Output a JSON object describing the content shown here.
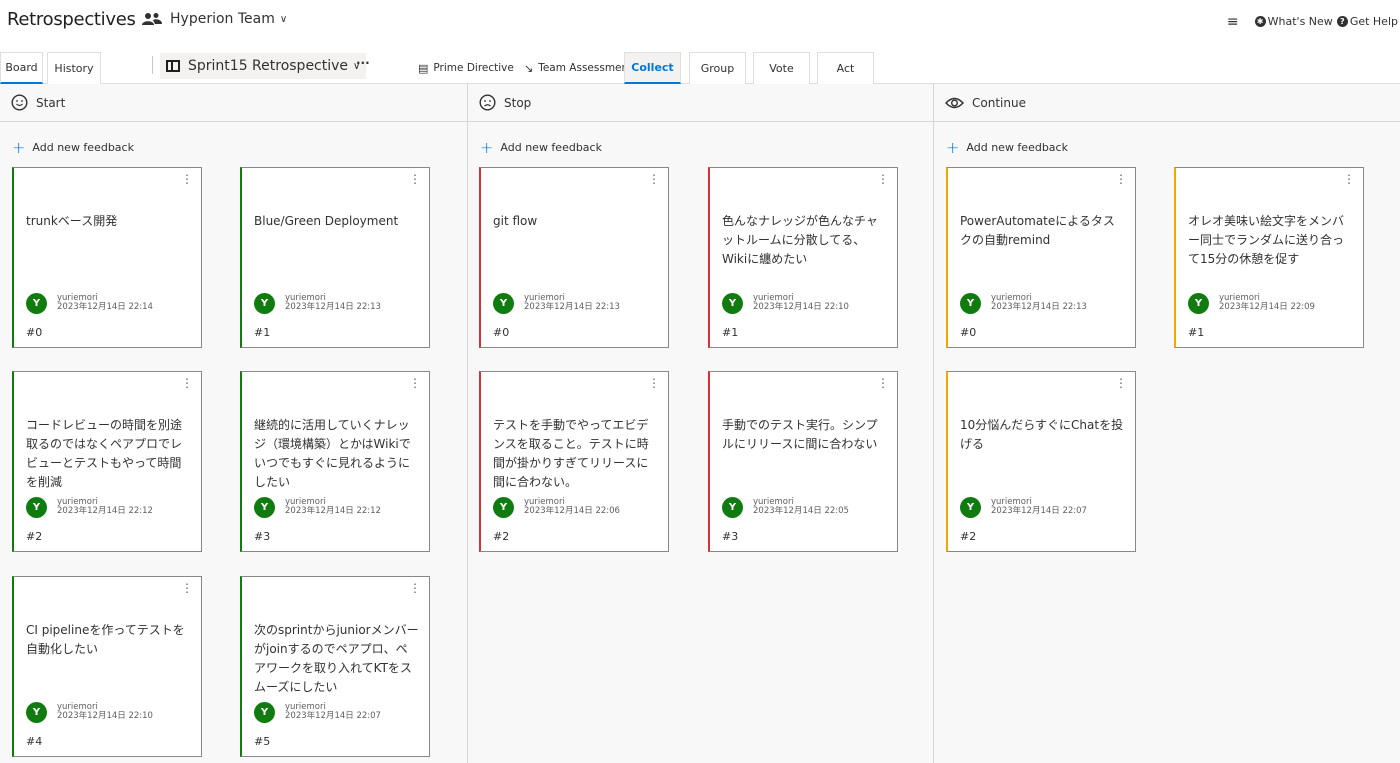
{
  "app": {
    "title": "Retrospectives",
    "team_name": "Hyperion Team",
    "menu_icon": "hamburger-icon",
    "whats_new": "What's New",
    "get_help": "Get Help"
  },
  "tabs": {
    "board": "Board",
    "history": "History",
    "sprint_name": "Sprint15 Retrospective",
    "more": "···",
    "prime_directive": "Prime Directive",
    "team_assessment": "Team Assessment",
    "collect": "Collect",
    "group": "Group",
    "vote": "Vote",
    "act": "Act"
  },
  "colors": {
    "accent": "#0078d4",
    "start": "#107c10",
    "stop": "#d13438",
    "continue": "#f7a600",
    "avatar": "#107c10"
  },
  "columns": [
    {
      "title": "Start",
      "icon": "smile-icon",
      "add_label": "Add new feedback",
      "cards": [
        {
          "text": "trunkベース開発",
          "initial": "Y",
          "author": "yuriemori",
          "date": "2023年12月14日 22:14",
          "num": "#0"
        },
        {
          "text": "Blue/Green Deployment",
          "initial": "Y",
          "author": "yuriemori",
          "date": "2023年12月14日 22:13",
          "num": "#1"
        },
        {
          "text": "コードレビューの時間を別途取るのではなくペアプロでレビューとテストもやって時間を削減",
          "initial": "Y",
          "author": "yuriemori",
          "date": "2023年12月14日 22:12",
          "num": "#2"
        },
        {
          "text": "継続的に活用していくナレッジ（環境構築）とかはWikiでいつでもすぐに見れるようにしたい",
          "initial": "Y",
          "author": "yuriemori",
          "date": "2023年12月14日 22:12",
          "num": "#3"
        },
        {
          "text": "CI pipelineを作ってテストを自動化したい",
          "initial": "Y",
          "author": "yuriemori",
          "date": "2023年12月14日 22:10",
          "num": "#4"
        },
        {
          "text": "次のsprintからjuniorメンバーがjoinするのでペアプロ、ペアワークを取り入れてKTをスムーズにしたい",
          "initial": "Y",
          "author": "yuriemori",
          "date": "2023年12月14日 22:07",
          "num": "#5"
        }
      ]
    },
    {
      "title": "Stop",
      "icon": "frown-icon",
      "add_label": "Add new feedback",
      "cards": [
        {
          "text": "git flow",
          "initial": "Y",
          "author": "yuriemori",
          "date": "2023年12月14日 22:13",
          "num": "#0"
        },
        {
          "text": "色んなナレッジが色んなチャットルームに分散してる、Wikiに纏めたい",
          "initial": "Y",
          "author": "yuriemori",
          "date": "2023年12月14日 22:10",
          "num": "#1"
        },
        {
          "text": "テストを手動でやってエビデンスを取ること。テストに時間が掛かりすぎてリリースに間に合わない。",
          "initial": "Y",
          "author": "yuriemori",
          "date": "2023年12月14日 22:06",
          "num": "#2"
        },
        {
          "text": "手動でのテスト実行。シンプルにリリースに間に合わない",
          "initial": "Y",
          "author": "yuriemori",
          "date": "2023年12月14日 22:05",
          "num": "#3"
        }
      ]
    },
    {
      "title": "Continue",
      "icon": "eye-icon",
      "add_label": "Add new feedback",
      "cards": [
        {
          "text": "PowerAutomateによるタスクの自動remind",
          "initial": "Y",
          "author": "yuriemori",
          "date": "2023年12月14日 22:13",
          "num": "#0"
        },
        {
          "text": "オレオ美味い絵文字をメンバー同士でランダムに送り合って15分の休憩を促す",
          "initial": "Y",
          "author": "yuriemori",
          "date": "2023年12月14日 22:09",
          "num": "#1"
        },
        {
          "text": "10分悩んだらすぐにChatを投げる",
          "initial": "Y",
          "author": "yuriemori",
          "date": "2023年12月14日 22:07",
          "num": "#2"
        }
      ]
    }
  ]
}
